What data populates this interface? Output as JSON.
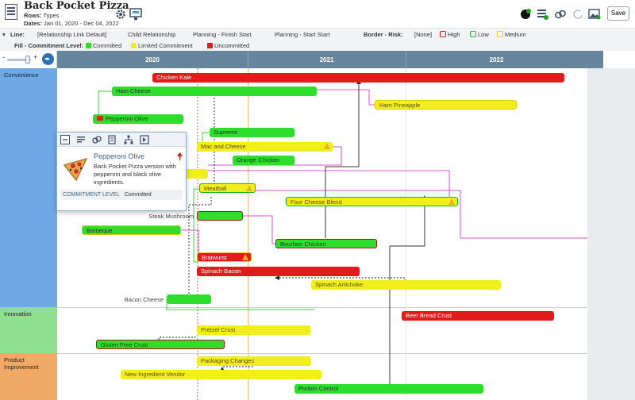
{
  "header": {
    "title": "Back Pocket Pizza",
    "rows_label": "Rows:",
    "rows_value": "Types",
    "dates_label": "Dates:",
    "dates_value": "Jan 01, 2020 - Dec 04, 2022",
    "save_label": "Save"
  },
  "legend": {
    "line_label": "Line:",
    "line_items": [
      "[Relationship Link Default]",
      "Child Relationship",
      "Planning - Finish Start",
      "Planning - Start Start"
    ],
    "border_label": "Border - Risk:",
    "border_items": [
      "[None]",
      "High",
      "Low",
      "Medium"
    ],
    "fill_label": "Fill - Commitment Level:",
    "fill_items": [
      "Committed",
      "Limited Commitment",
      "Uncommitted"
    ]
  },
  "timeline": {
    "years": [
      "2020",
      "2021",
      "2022"
    ]
  },
  "lanes": [
    "Convenience",
    "Innovation",
    "Product Improvement"
  ],
  "bars": [
    "Chicken Kale",
    "Ham Cheese",
    "Ham Pineapple",
    "Pepperoni Olive",
    "Supreme",
    "Mac and Cheese",
    "Orange Chicken",
    "Meatball",
    "Four Cheese Blend",
    "Barbeque",
    "Bourbon Chicken",
    "Bratwurst",
    "Spinach Bacon",
    "Spinach Artichoke",
    "Beer Bread Crust",
    "Pretzel Crust",
    "Gluten Free Crust",
    "Packaging Changes",
    "New Ingredient Vendor",
    "Portion Control"
  ],
  "outside_labels": [
    "Steak Mushroom",
    "Bacon Cheese"
  ],
  "card": {
    "title": "Pepperoni Olive",
    "description": "Back Pocket Pizza version with pepperoni and black olive ingredients.",
    "footer_label": "COMMITMENT LEVEL",
    "footer_value": "Committed"
  },
  "colors": {
    "committed": "#2dde2d",
    "limited": "#f1ee1c",
    "uncommitted": "#e21b1b",
    "header_bar": "#67869e",
    "lane1": "#6fa8e6",
    "lane2": "#8ee08e",
    "lane3": "#f2a968"
  },
  "icons": [
    "gear-icon",
    "hierarchy-icon",
    "new-item-icon",
    "list-icon",
    "link-icon",
    "undo-icon",
    "image-icon",
    "pin-icon"
  ]
}
